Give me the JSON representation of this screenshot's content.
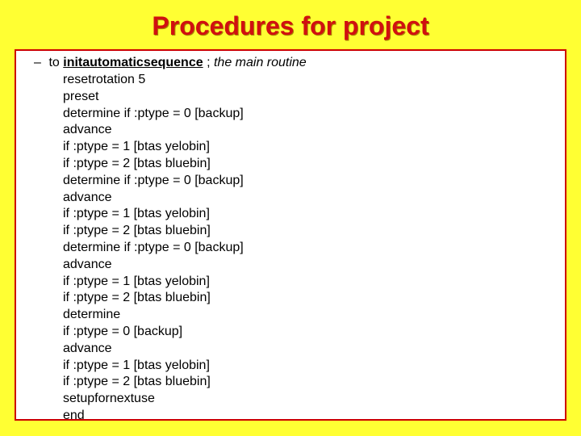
{
  "title": "Procedures for project",
  "dash": "–",
  "to_word": "to ",
  "procname": "initautomaticsequence",
  "separator": " ; ",
  "comment": "the main routine",
  "code": "resetrotation 5\npreset\ndetermine if :ptype = 0 [backup]\nadvance\nif :ptype = 1 [btas yelobin]\nif :ptype = 2 [btas bluebin]\ndetermine if :ptype = 0 [backup]\nadvance\nif :ptype = 1 [btas yelobin]\nif :ptype = 2 [btas bluebin]\ndetermine if :ptype = 0 [backup]\nadvance\nif :ptype = 1 [btas yelobin]\nif :ptype = 2 [btas bluebin]\ndetermine\nif :ptype = 0 [backup]\nadvance\nif :ptype = 1 [btas yelobin]\nif :ptype = 2 [btas bluebin]\nsetupfornextuse\nend"
}
